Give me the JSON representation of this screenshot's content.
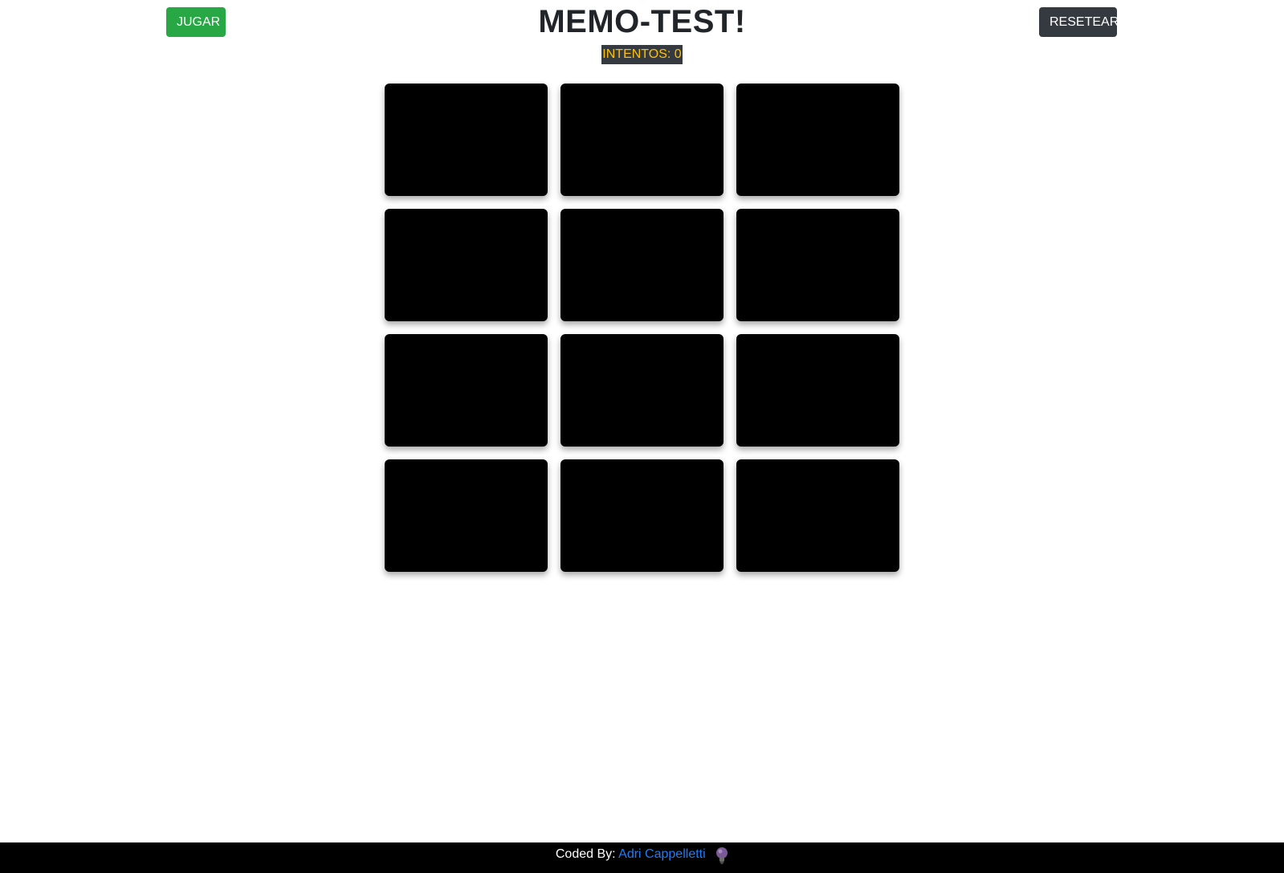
{
  "header": {
    "play_label": "JUGAR",
    "title": "MEMO-TEST!",
    "reset_label": "RESETEAR",
    "attempts_text": "INTENTOS: 0"
  },
  "board": {
    "rows": 4,
    "columns": 3,
    "card_count": 12,
    "card_state": "face-down",
    "card_color": "#000000"
  },
  "footer": {
    "prefix": "Coded By:",
    "author": "Adri Cappelletti",
    "avatar_icon": "bulb-avatar-icon"
  },
  "colors": {
    "play_button": "#28a745",
    "reset_button": "#343a40",
    "attempts_text": "#ffc107",
    "attempts_background": "#343a40",
    "footer_background": "#000000",
    "author_link": "#1e7cf5"
  }
}
